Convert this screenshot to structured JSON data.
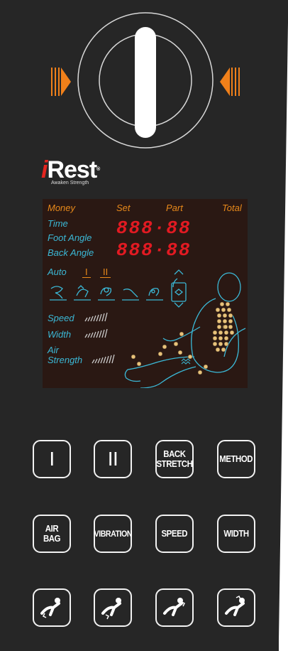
{
  "brand": {
    "name_prefix": "i",
    "name_rest": "Rest",
    "registered": "®",
    "tagline": "Awaken Strength"
  },
  "colors": {
    "panel": "#262626",
    "lcd_bg": "#2a1813",
    "lcd_orange": "#e8891a",
    "lcd_blue": "#3bb8d6",
    "segment_red": "#e21a22",
    "brand_red": "#e4251f",
    "arrow_orange": "#f0801a"
  },
  "lcd": {
    "header": {
      "money": "Money",
      "set": "Set",
      "part": "Part",
      "total": "Total"
    },
    "labels": {
      "time": "Time",
      "foot_angle": "Foot Angle",
      "back_angle": "Back Angle"
    },
    "display_row1": "888·88",
    "display_row2": "888·88",
    "auto": {
      "label": "Auto",
      "mode1": "I",
      "mode2": "II"
    },
    "levels": {
      "speed": "Speed",
      "width": "Width",
      "air": "Air",
      "strength": "Strength"
    }
  },
  "buttons": {
    "row1": [
      {
        "name": "program-1-button",
        "label": "I"
      },
      {
        "name": "program-2-button",
        "label": "II"
      },
      {
        "name": "back-stretch-button",
        "label": "BACK\nSTRETCH"
      },
      {
        "name": "method-button",
        "label": "METHOD"
      }
    ],
    "row2": [
      {
        "name": "air-bag-button",
        "label": "AIR BAG"
      },
      {
        "name": "vibration-button",
        "label": "VIBRATION"
      },
      {
        "name": "speed-button",
        "label": "SPEED"
      },
      {
        "name": "width-button",
        "label": "WIDTH"
      }
    ],
    "row3_icons": [
      "recline-foot-down-icon",
      "recline-foot-up-icon",
      "recline-back-down-icon",
      "recline-back-up-icon"
    ]
  }
}
